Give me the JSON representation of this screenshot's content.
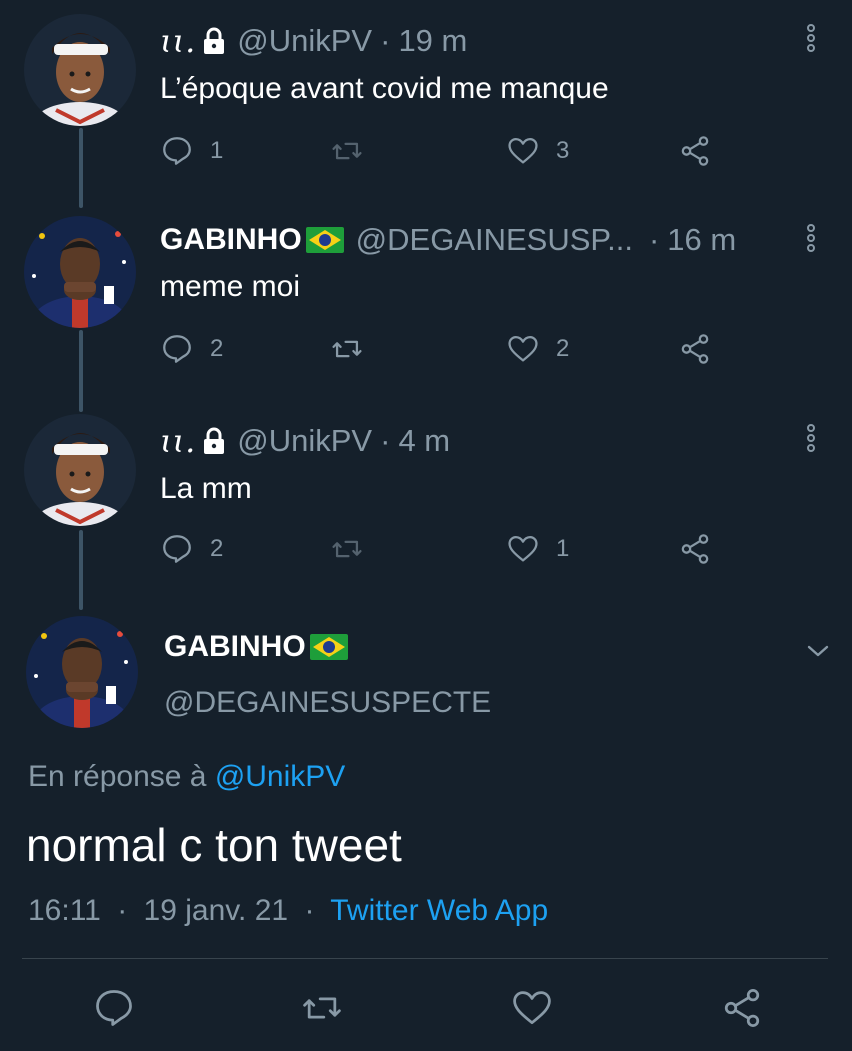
{
  "tweets": [
    {
      "name_glyph": "ɩɩ.",
      "display_name": "",
      "handle": "@UnikPV",
      "separator": "·",
      "time": "19 m",
      "text": "L’époque avant covid me manque",
      "reply_count": "1",
      "retweet_count": "",
      "like_count": "3",
      "locked": true
    },
    {
      "display_name": "GABINHO",
      "handle": "@DEGAINESUSP...",
      "separator": "·",
      "time": "16 m",
      "text": "meme moi",
      "reply_count": "2",
      "retweet_count": "",
      "like_count": "2",
      "flag": "brazil-flag-icon"
    },
    {
      "name_glyph": "ɩɩ.",
      "handle": "@UnikPV",
      "separator": "·",
      "time": "4 m",
      "text": "La mm",
      "reply_count": "2",
      "retweet_count": "",
      "like_count": "1",
      "locked": true
    }
  ],
  "main_tweet": {
    "display_name": "GABINHO",
    "handle": "@DEGAINESUSPECTE",
    "reply_prefix": "En réponse à",
    "reply_mention": "@UnikPV",
    "text": "normal c ton tweet",
    "time": "16:11",
    "separator": "·",
    "date": "19 janv. 21",
    "source": "Twitter Web App"
  },
  "colors": {
    "background": "#15202b",
    "secondary_text": "#8899a6",
    "accent": "#1da1f2",
    "divider": "#38444d"
  }
}
